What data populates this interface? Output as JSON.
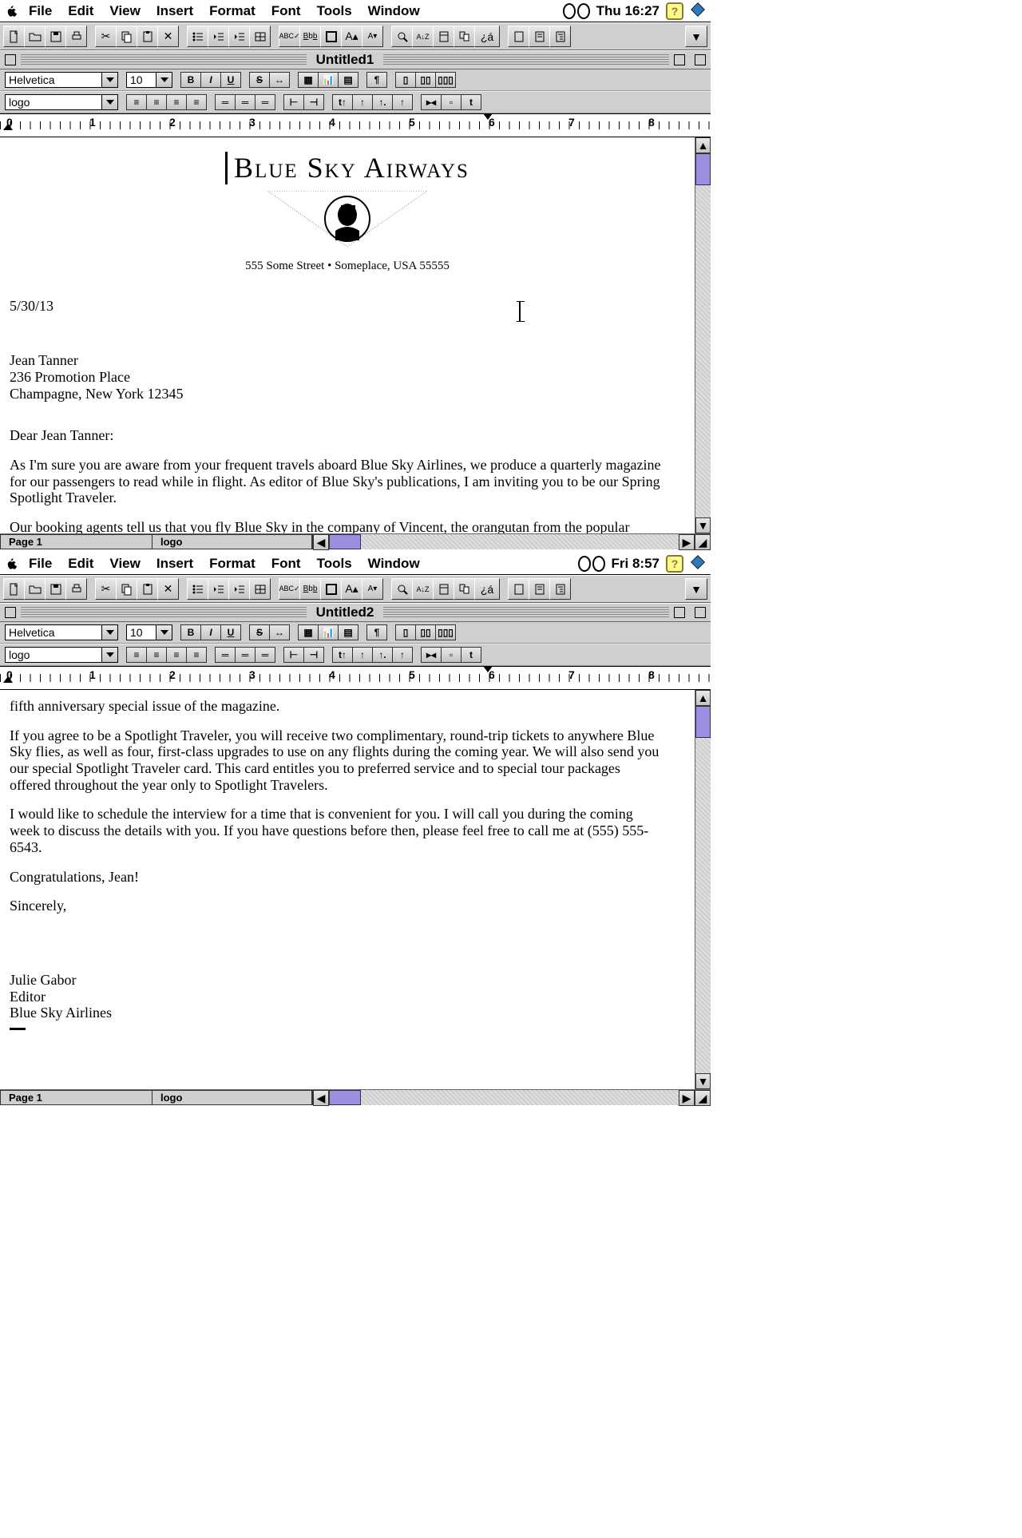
{
  "menus": [
    "File",
    "Edit",
    "View",
    "Insert",
    "Format",
    "Font",
    "Tools",
    "Window"
  ],
  "screen1": {
    "clock": "Thu 16:27",
    "title": "Untitled1",
    "font_name": "Helvetica",
    "font_size": "10",
    "style_name": "logo",
    "ruler_numbers": [
      "0",
      "1",
      "2",
      "3",
      "4",
      "5",
      "6",
      "7",
      "8"
    ],
    "status_page": "Page 1",
    "status_style": "logo",
    "letterhead": {
      "company": "Blue Sky Airways",
      "address": "555 Some Street • Someplace, USA 55555"
    },
    "date": "5/30/13",
    "recipient_name": "Jean Tanner",
    "recipient_addr1": "236 Promotion Place",
    "recipient_addr2": "Champagne, New York 12345",
    "salutation": "Dear Jean Tanner:",
    "p1": "As I'm sure you are aware from your frequent travels aboard Blue Sky Airlines, we produce a quarterly magazine for our passengers to read while in flight. As editor of Blue Sky's publications, I am inviting you to be our Spring Spotlight Traveler.",
    "p2": "Our booking agents tell us that you fly Blue Sky in the company of Vincent, the orangutan from the popular television show. Would you be willing to be interviewed and to pose for some photos, preferably with Vincent? We'd love to publish this story in our"
  },
  "screen2": {
    "clock": "Fri 8:57",
    "title": "Untitled2",
    "font_name": "Helvetica",
    "font_size": "10",
    "style_name": "logo",
    "ruler_numbers": [
      "0",
      "1",
      "2",
      "3",
      "4",
      "5",
      "6",
      "7",
      "8"
    ],
    "status_page": "Page 1",
    "status_style": "logo",
    "p1": "fifth anniversary special issue of the magazine.",
    "p2": "If you agree to be a Spotlight Traveler, you will receive two complimentary, round-trip tickets to anywhere Blue Sky flies, as well as four, first-class upgrades to use on any flights during the coming year. We will also send you our special Spotlight Traveler card. This card entitles you to preferred service and to special tour packages offered throughout the year only to Spotlight Travelers.",
    "p3": "I would like to schedule the interview for a time that is convenient for you. I will call you during the coming week to discuss the details with you. If you have questions before then, please feel free to call me at (555) 555-6543.",
    "p4": "Congratulations, Jean!",
    "closing": "Sincerely,",
    "signer_name": "Julie Gabor",
    "signer_title": "Editor",
    "signer_company": "Blue Sky Airlines"
  }
}
